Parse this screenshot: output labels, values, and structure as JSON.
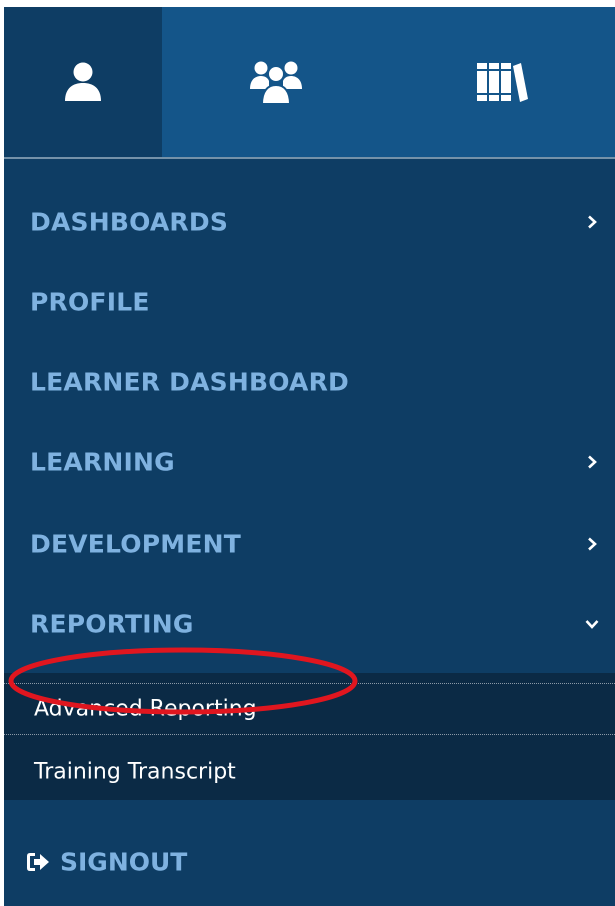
{
  "tabs": {
    "items": [
      {
        "icon": "user-icon",
        "active": true
      },
      {
        "icon": "users-group-icon",
        "active": false
      },
      {
        "icon": "library-books-icon",
        "active": false
      }
    ]
  },
  "menu": {
    "items": [
      {
        "label": "DASHBOARDS",
        "chevron": "right"
      },
      {
        "label": "PROFILE",
        "chevron": ""
      },
      {
        "label": "LEARNER DASHBOARD",
        "chevron": ""
      },
      {
        "label": "LEARNING",
        "chevron": "right"
      },
      {
        "label": "DEVELOPMENT",
        "chevron": "right"
      },
      {
        "label": "REPORTING",
        "chevron": "down"
      }
    ],
    "reporting_submenu": [
      {
        "label": "Advanced Reporting",
        "highlighted": true
      },
      {
        "label": "Training Transcript",
        "highlighted": false
      }
    ],
    "signout": {
      "label": "SIGNOUT",
      "icon": "signout-icon"
    }
  },
  "colors": {
    "panel_bg": "#0e3d64",
    "tab_bg": "#145589",
    "menu_text": "#7fb2e0",
    "submenu_bg": "#0b2a45",
    "highlight": "#e0161f"
  }
}
